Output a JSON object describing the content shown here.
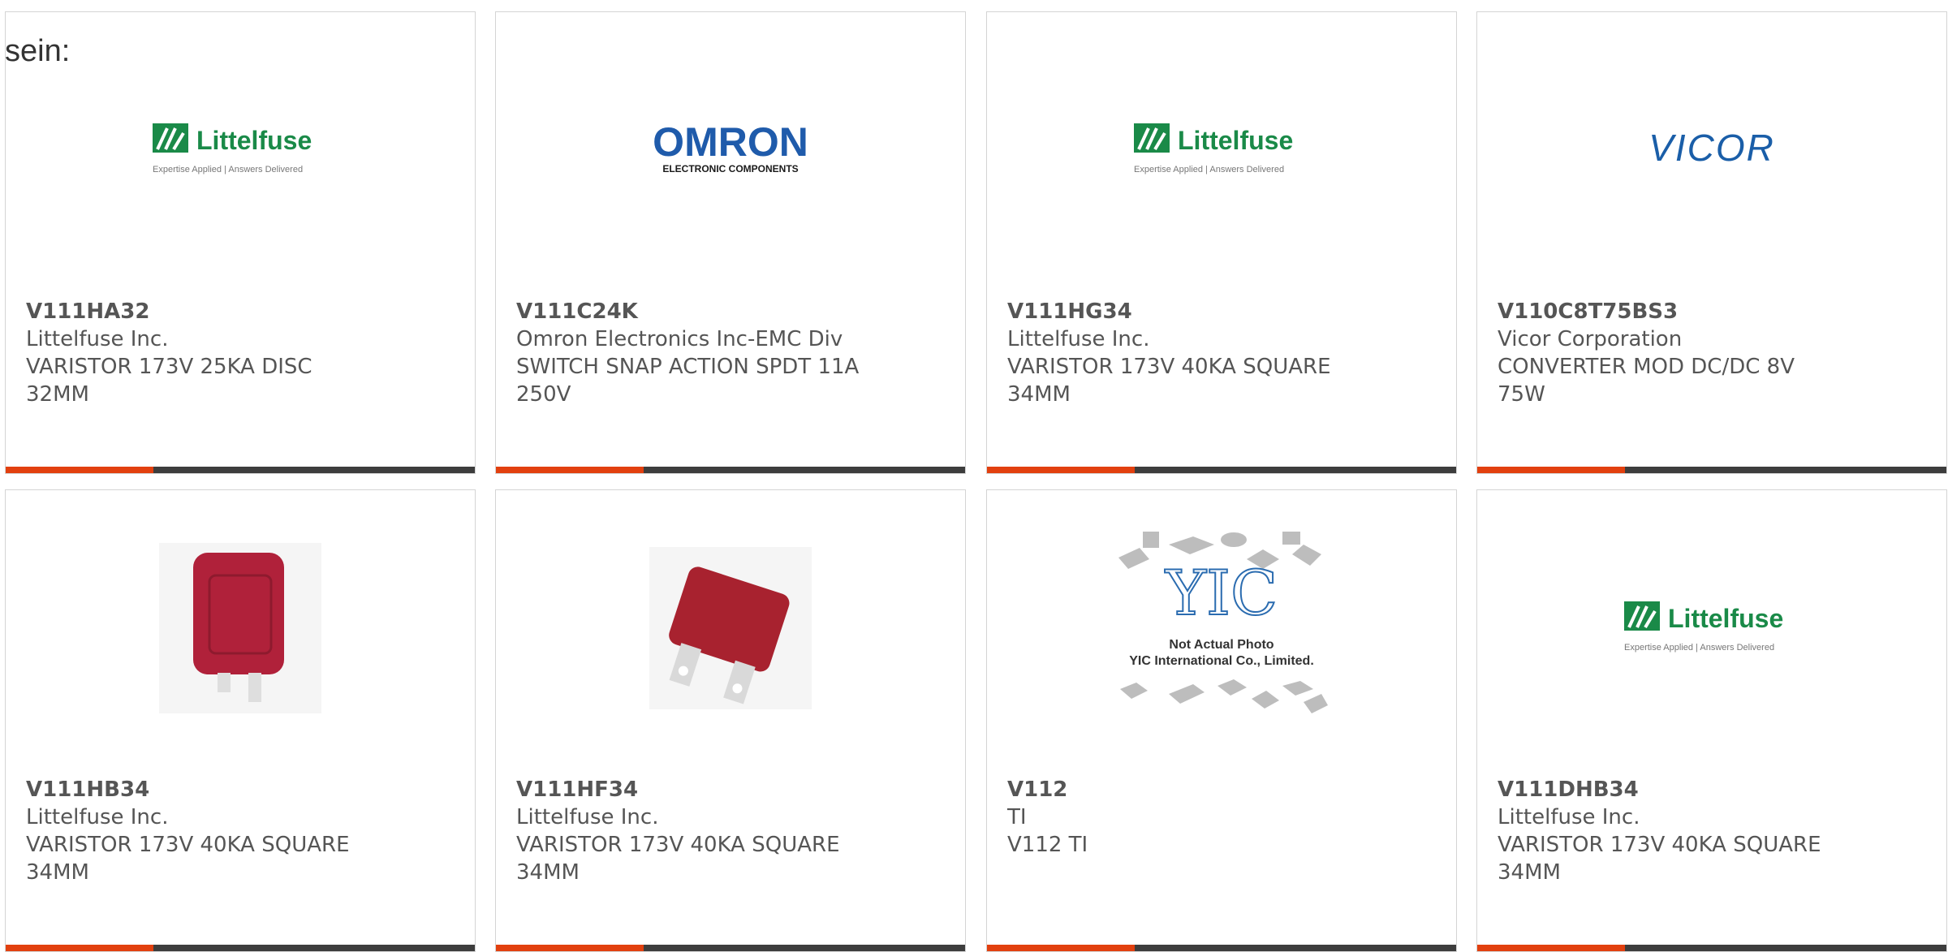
{
  "intro_text": "sein:",
  "colors": {
    "accent": "#e2400f",
    "bar": "#3d3d3d",
    "border": "#d4d4d4",
    "text": "#555555",
    "littelfuse_green": "#1a8a48",
    "omron_blue": "#1f5bab",
    "vicor_blue": "#1a5ea8"
  },
  "littelfuse_logo": {
    "name": "Littelfuse",
    "tagline": "Expertise Applied | Answers Delivered"
  },
  "omron_logo": {
    "name": "OMRON",
    "sub": "ELECTRONIC COMPONENTS"
  },
  "vicor_logo": {
    "name": "VICOR"
  },
  "yic_placeholder": {
    "name": "YIC",
    "line1": "Not Actual Photo",
    "line2": "YIC International Co., Limited."
  },
  "products": [
    {
      "image": "littelfuse-logo",
      "part_number": "V111HA32",
      "manufacturer": "Littelfuse Inc.",
      "description": "VARISTOR 173V 25KA DISC 32MM"
    },
    {
      "image": "omron-logo",
      "part_number": "V111C24K",
      "manufacturer": "Omron Electronics Inc-EMC Div",
      "description": "SWITCH SNAP ACTION SPDT 11A 250V"
    },
    {
      "image": "littelfuse-logo",
      "part_number": "V111HG34",
      "manufacturer": "Littelfuse Inc.",
      "description": "VARISTOR 173V 40KA SQUARE 34MM"
    },
    {
      "image": "vicor-logo",
      "part_number": "V110C8T75BS3",
      "manufacturer": "Vicor Corporation",
      "description": "CONVERTER MOD DC/DC 8V 75W"
    },
    {
      "image": "varistor-photo",
      "part_number": "V111HB34",
      "manufacturer": "Littelfuse Inc.",
      "description": "VARISTOR 173V 40KA SQUARE 34MM"
    },
    {
      "image": "varistor-photo",
      "part_number": "V111HF34",
      "manufacturer": "Littelfuse Inc.",
      "description": "VARISTOR 173V 40KA SQUARE 34MM"
    },
    {
      "image": "yic-placeholder",
      "part_number": "V112",
      "manufacturer": "TI",
      "description": "V112 TI"
    },
    {
      "image": "littelfuse-logo",
      "part_number": "V111DHB34",
      "manufacturer": "Littelfuse Inc.",
      "description": "VARISTOR 173V 40KA SQUARE 34MM"
    }
  ]
}
